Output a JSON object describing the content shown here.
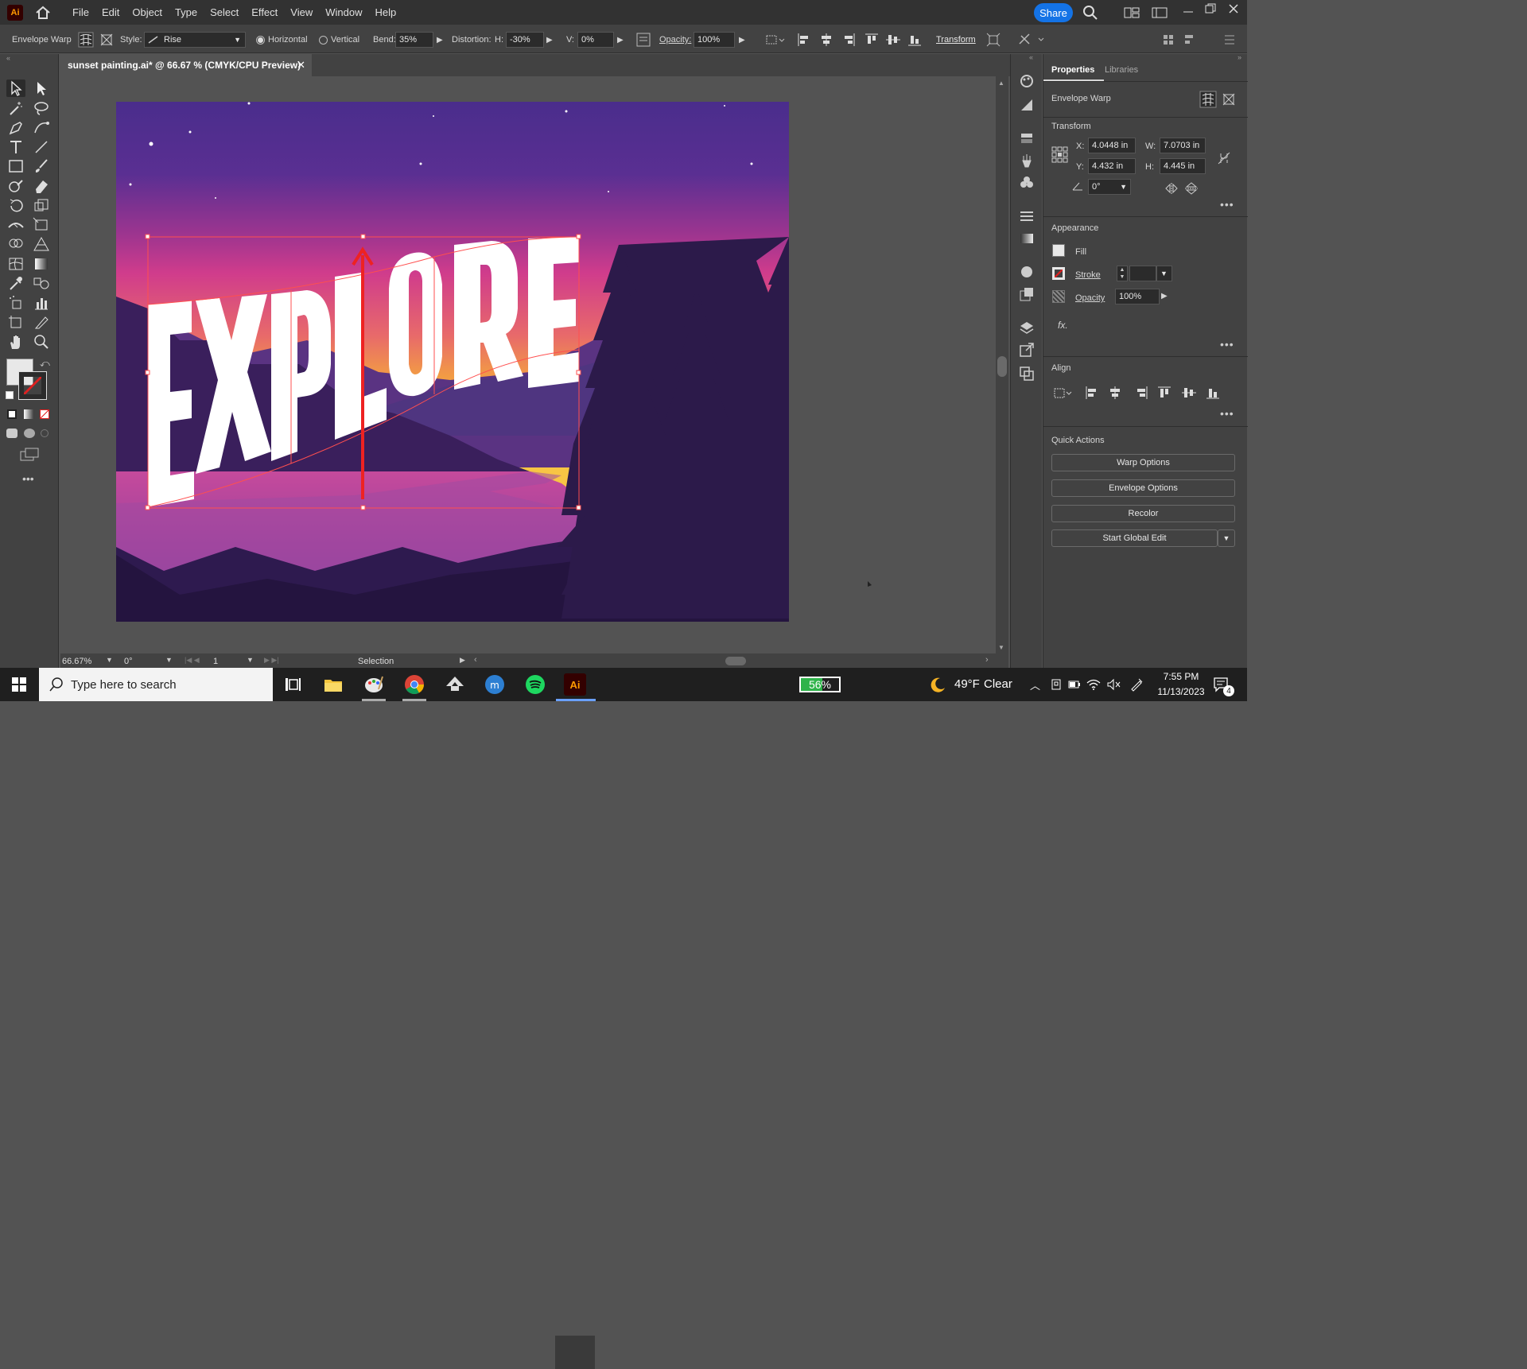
{
  "app": {
    "logo": "Ai",
    "menu": [
      "File",
      "Edit",
      "Object",
      "Type",
      "Select",
      "Effect",
      "View",
      "Window",
      "Help"
    ],
    "share_label": "Share"
  },
  "control_bar": {
    "selection_label": "Envelope Warp",
    "style_label": "Style:",
    "style_value": "Rise",
    "horizontal_label": "Horizontal",
    "vertical_label": "Vertical",
    "bend_label": "Bend:",
    "bend_value": "35%",
    "distortion_label": "Distortion:",
    "h_label": "H:",
    "h_value": "-30%",
    "v_label": "V:",
    "v_value": "0%",
    "opacity_label": "Opacity:",
    "opacity_value": "100%",
    "transform_label": "Transform",
    "orientation": "horizontal"
  },
  "document": {
    "tab_title": "sunset painting.ai* @ 66.67 % (CMYK/CPU Preview)",
    "artwork_text": "EXPLORE"
  },
  "status_bar": {
    "zoom": "66.67%",
    "rotation": "0°",
    "artboard": "1",
    "tool": "Selection"
  },
  "properties": {
    "tabs": [
      "Properties",
      "Libraries"
    ],
    "selection": "Envelope Warp",
    "transform_title": "Transform",
    "x_label": "X:",
    "x_value": "4.0448 in",
    "y_label": "Y:",
    "y_value": "4.432 in",
    "w_label": "W:",
    "w_value": "7.0703 in",
    "h_label": "H:",
    "h_value": "4.445 in",
    "angle_value": "0°",
    "appearance_title": "Appearance",
    "fill_label": "Fill",
    "stroke_label": "Stroke",
    "opacity_label": "Opacity",
    "opacity_value": "100%",
    "fx_label": "fx.",
    "align_title": "Align",
    "quick_actions_title": "Quick Actions",
    "quick_actions": [
      "Warp Options",
      "Envelope Options",
      "Recolor",
      "Start Global Edit"
    ]
  },
  "taskbar": {
    "search_placeholder": "Type here to search",
    "battery": "56%",
    "weather_temp": "49°F",
    "weather_desc": "Clear",
    "time": "7:55 PM",
    "date": "11/13/2023",
    "notifications": "4",
    "app_icon_label": "Ai"
  },
  "colors": {
    "accent": "#1473e6",
    "illustrator": "#ff9a00",
    "selection": "#ff4f4f",
    "sky_top": "#4a2d8c",
    "sky_mid": "#d03c8c",
    "sky_low": "#f5a93a"
  }
}
